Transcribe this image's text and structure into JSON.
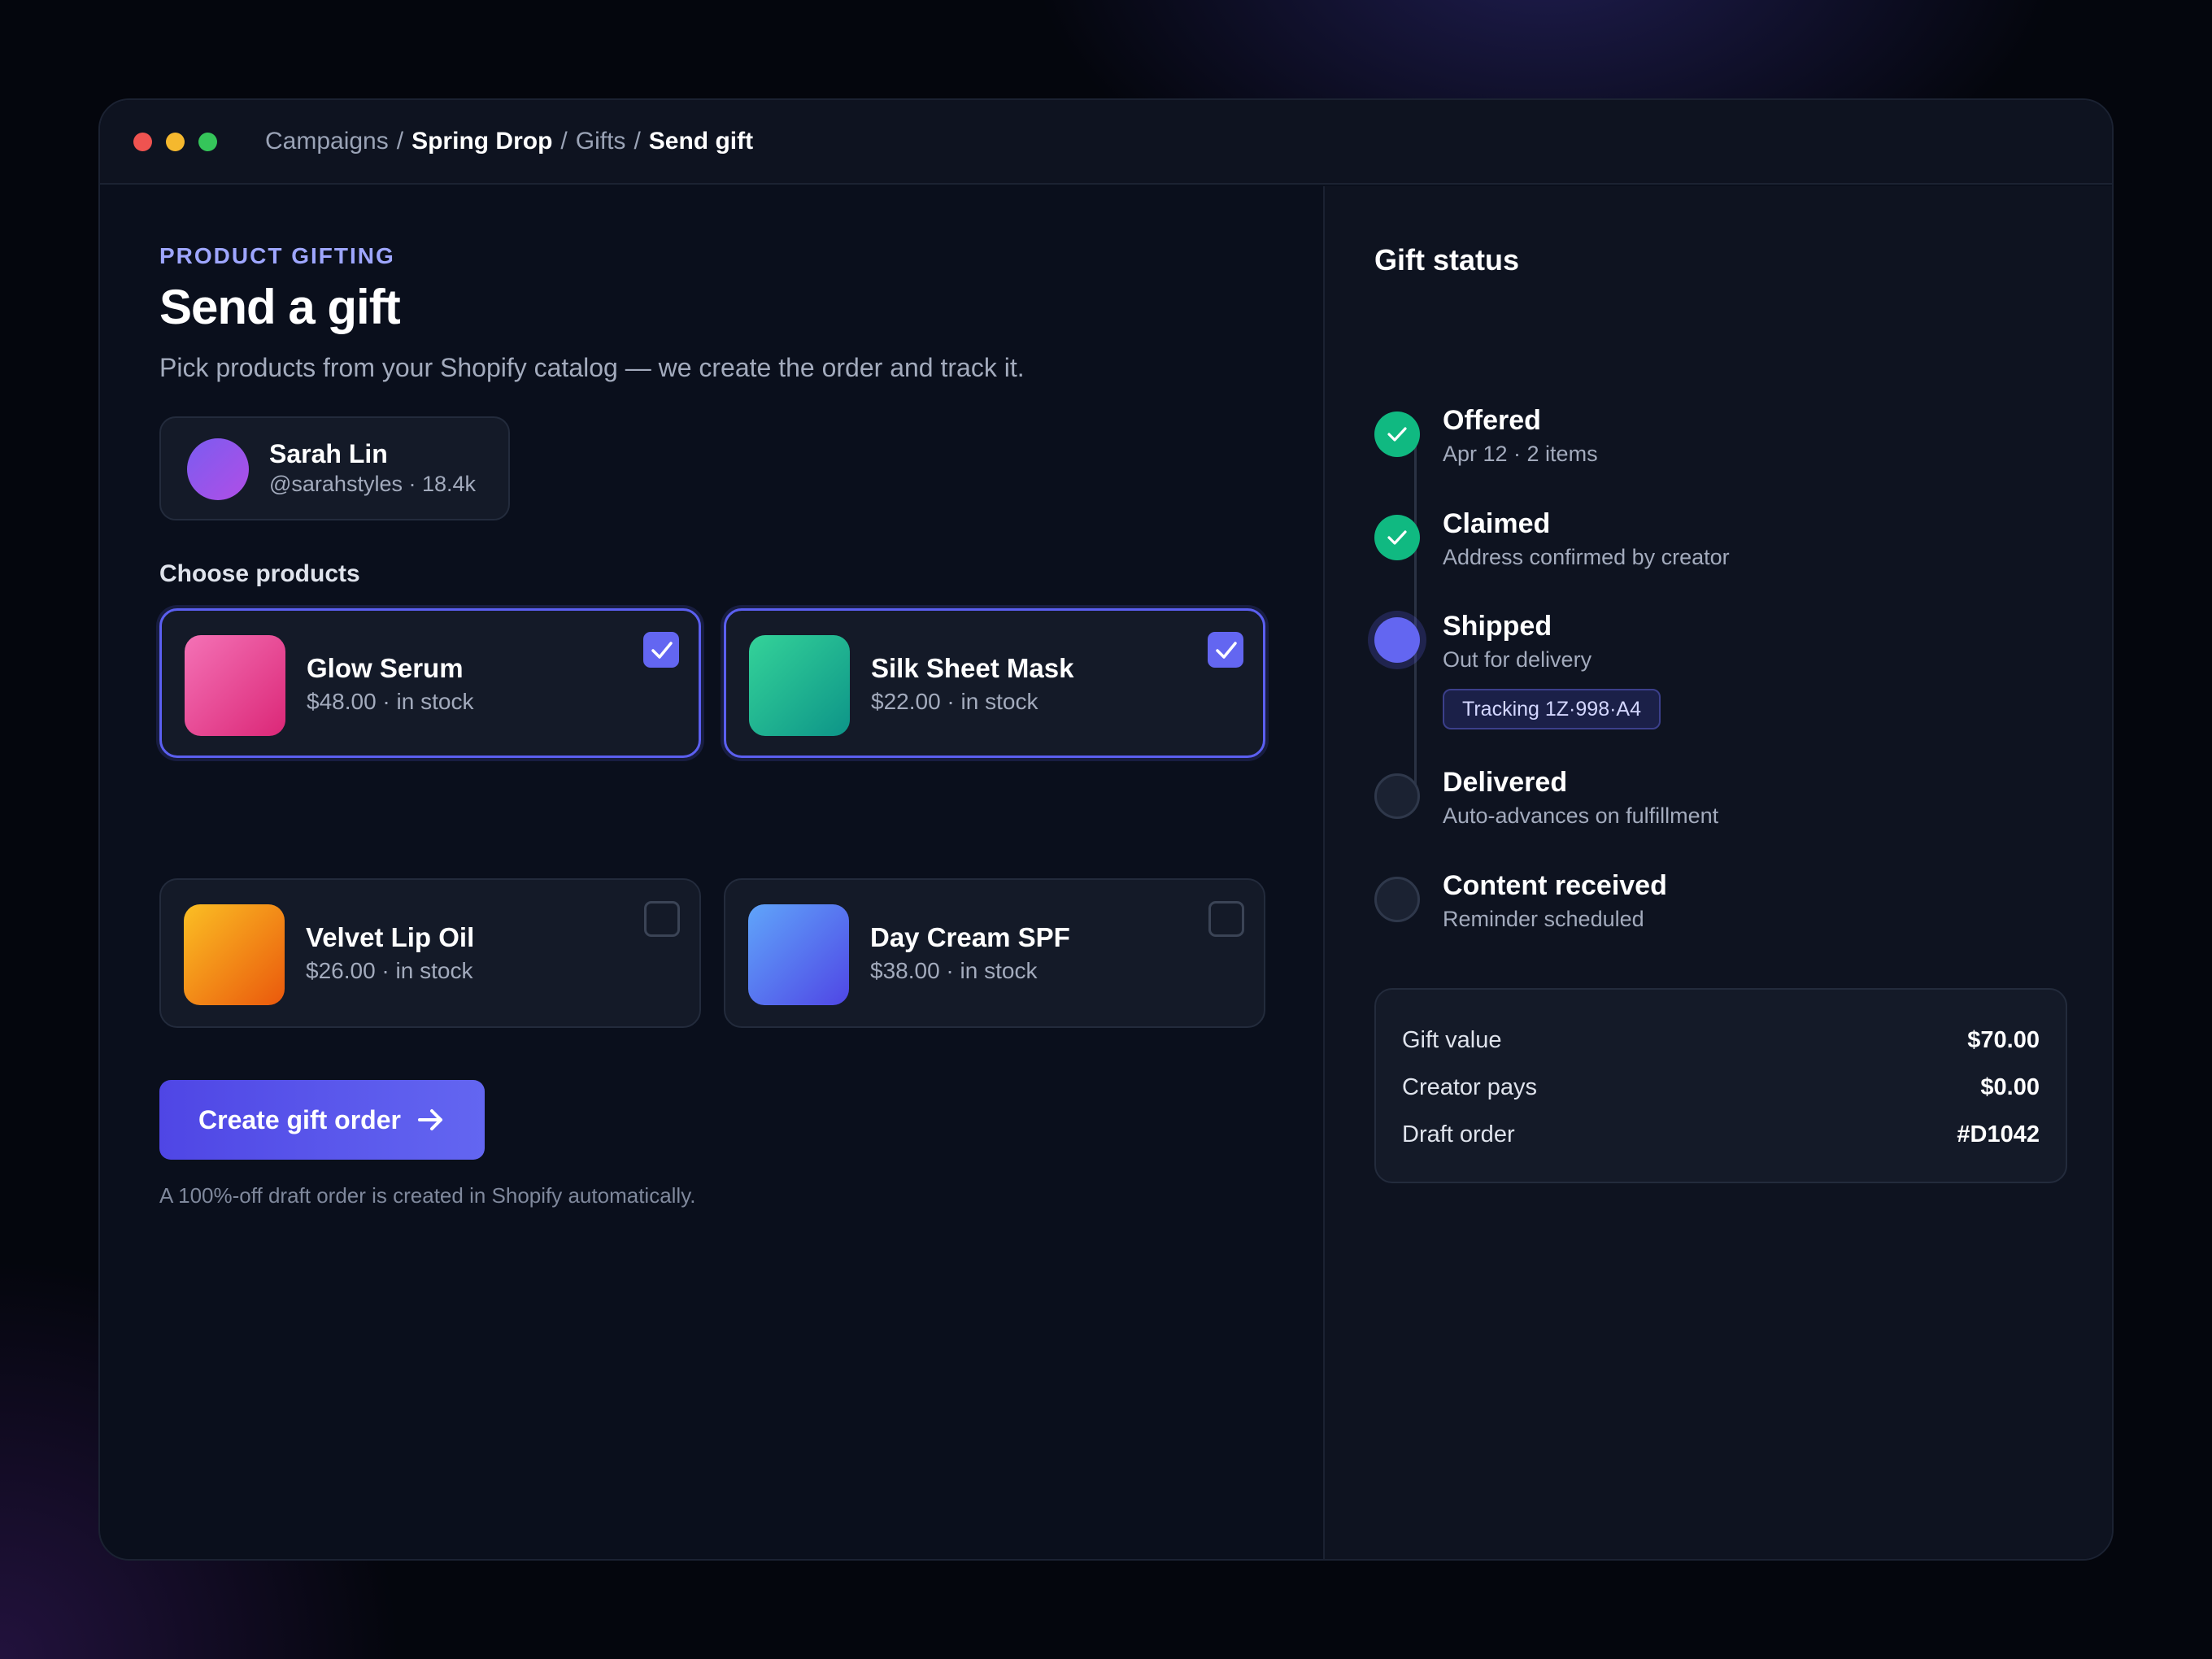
{
  "window": {
    "breadcrumb": {
      "part1": "Campaigns",
      "sep1": "/",
      "part2": "Spring Drop",
      "sep2": "/",
      "part3": "Gifts",
      "sep3": "/",
      "part4": "Send gift"
    }
  },
  "main": {
    "eyebrow": "PRODUCT GIFTING",
    "title": "Send a gift",
    "subtitle": "Pick products from your Shopify catalog — we create the order and track it.",
    "creator": {
      "name": "Sarah Lin",
      "handle": "@sarahstyles · 18.4k"
    },
    "products_label": "Choose products",
    "products": [
      {
        "name": "Glow Serum",
        "meta": "$48.00 · in stock",
        "selected": true,
        "color_a": "#f472b6",
        "color_b": "#db2777"
      },
      {
        "name": "Silk Sheet Mask",
        "meta": "$22.00 · in stock",
        "selected": true,
        "color_a": "#34d399",
        "color_b": "#0d9488"
      },
      {
        "name": "Velvet Lip Oil",
        "meta": "$26.00 · in stock",
        "selected": false,
        "color_a": "#fbbf24",
        "color_b": "#ea580c"
      },
      {
        "name": "Day Cream SPF",
        "meta": "$38.00 · in stock",
        "selected": false,
        "color_a": "#60a5fa",
        "color_b": "#4f46e5"
      }
    ],
    "cta_label": "Create gift order",
    "footnote": "A 100%-off draft order is created in Shopify automatically."
  },
  "aside": {
    "title": "Gift status",
    "steps": [
      {
        "title": "Offered",
        "sub": "Apr 12 · 2 items",
        "state": "done"
      },
      {
        "title": "Claimed",
        "sub": "Address confirmed by creator",
        "state": "done"
      },
      {
        "title": "Shipped",
        "sub": "Out for delivery",
        "state": "active",
        "badge": "Tracking 1Z·998·A4"
      },
      {
        "title": "Delivered",
        "sub": "Auto-advances on fulfillment",
        "state": "pending"
      },
      {
        "title": "Content received",
        "sub": "Reminder scheduled",
        "state": "pending"
      }
    ],
    "summary": [
      {
        "label": "Gift value",
        "value": "$70.00"
      },
      {
        "label": "Creator pays",
        "value": "$0.00"
      },
      {
        "label": "Draft order",
        "value": "#D1042"
      }
    ]
  },
  "colors": {
    "accent": "#6366f1",
    "success": "#10b981",
    "background": "#0a0f1c"
  }
}
